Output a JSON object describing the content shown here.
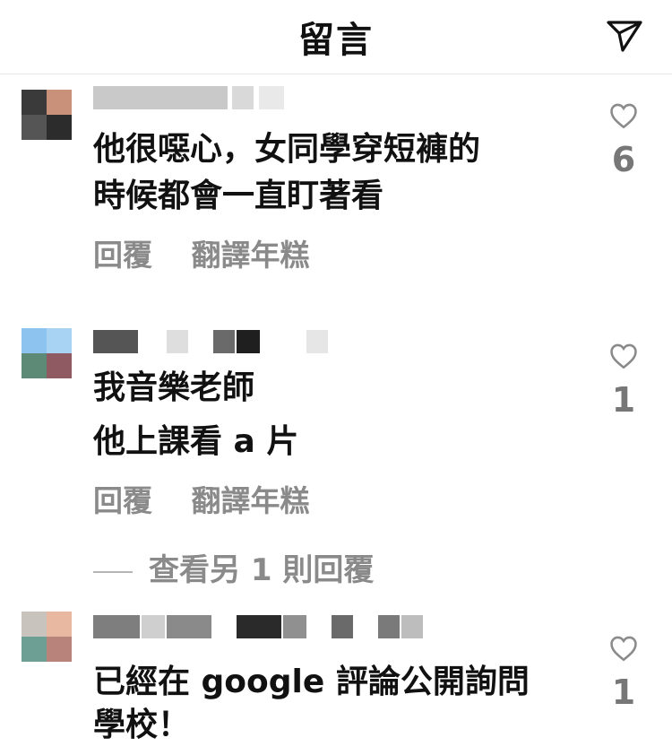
{
  "header": {
    "title": "留言"
  },
  "comments": [
    {
      "text_line1": "他很噁心，女同學穿短褲的",
      "text_line2": "時候都會一直盯著看",
      "reply_label": "回覆",
      "translate_label": "翻譯年糕",
      "likes": "6"
    },
    {
      "text_line1": "我音樂老師",
      "text_line2": "他上課看 a 片",
      "reply_label": "回覆",
      "translate_label": "翻譯年糕",
      "likes": "1"
    },
    {
      "text_line1": "已經在 google 評論公開詢問",
      "text_line2": "學校！",
      "likes": "1"
    }
  ],
  "view_more_replies": "查看另 1 則回覆",
  "icons": {
    "share": "send-icon",
    "like": "heart-outline-icon"
  },
  "colors": {
    "text": "#111111",
    "muted": "#8a8a8a",
    "divider": "#e6e6e6"
  }
}
